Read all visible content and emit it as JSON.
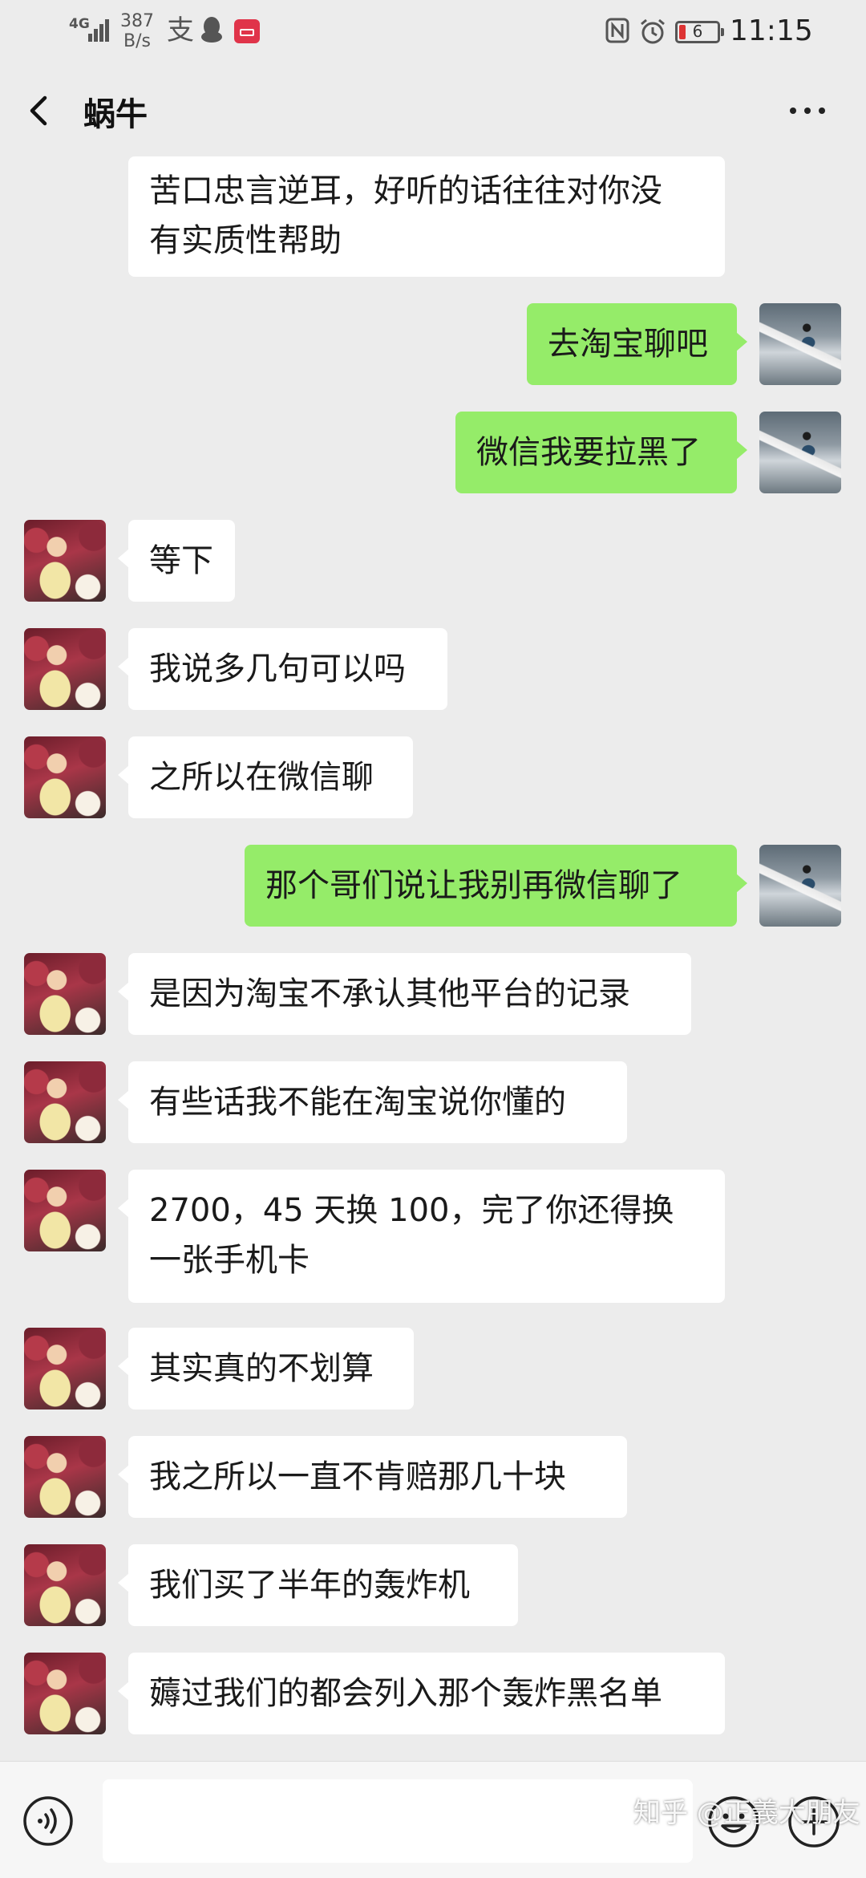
{
  "status_bar": {
    "network": "4G",
    "speed_value": "387",
    "speed_unit": "B/s",
    "pay_icon": "支",
    "battery": "6",
    "time": "11:15"
  },
  "header": {
    "title": "蜗牛"
  },
  "messages": [
    {
      "side": "in",
      "text": "苦口忠言逆耳，好听的话往往对你没\n有实质性帮助",
      "avatar": false
    },
    {
      "side": "out",
      "text": "去淘宝聊吧",
      "avatar": true
    },
    {
      "side": "out",
      "text": "微信我要拉黑了",
      "avatar": true
    },
    {
      "side": "in",
      "text": "等下",
      "avatar": true
    },
    {
      "side": "in",
      "text": "我说多几句可以吗",
      "avatar": true
    },
    {
      "side": "in",
      "text": "之所以在微信聊",
      "avatar": true
    },
    {
      "side": "out",
      "text": "那个哥们说让我别再微信聊了",
      "avatar": true
    },
    {
      "side": "in",
      "text": "是因为淘宝不承认其他平台的记录",
      "avatar": true
    },
    {
      "side": "in",
      "text": "有些话我不能在淘宝说你懂的",
      "avatar": true
    },
    {
      "side": "in",
      "text": "2700，45 天换 100，完了你还得换\n一张手机卡",
      "avatar": true
    },
    {
      "side": "in",
      "text": "其实真的不划算",
      "avatar": true
    },
    {
      "side": "in",
      "text": "我之所以一直不肯赔那几十块",
      "avatar": true
    },
    {
      "side": "in",
      "text": "我们买了半年的轰炸机",
      "avatar": true
    },
    {
      "side": "in",
      "text": "薅过我们的都会列入那个轰炸黑名单",
      "avatar": true
    }
  ],
  "input": {
    "value": "",
    "placeholder": ""
  },
  "watermark": "知乎 @正義大朋友",
  "colors": {
    "background": "#ececec",
    "bubble_incoming": "#ffffff",
    "bubble_outgoing": "#95ec69",
    "input_bar": "#f6f6f6"
  },
  "icons": {
    "back": "chevron-left-icon",
    "more": "more-dots-icon",
    "voice": "voice-icon",
    "emoji": "emoji-icon",
    "plus": "plus-icon"
  }
}
